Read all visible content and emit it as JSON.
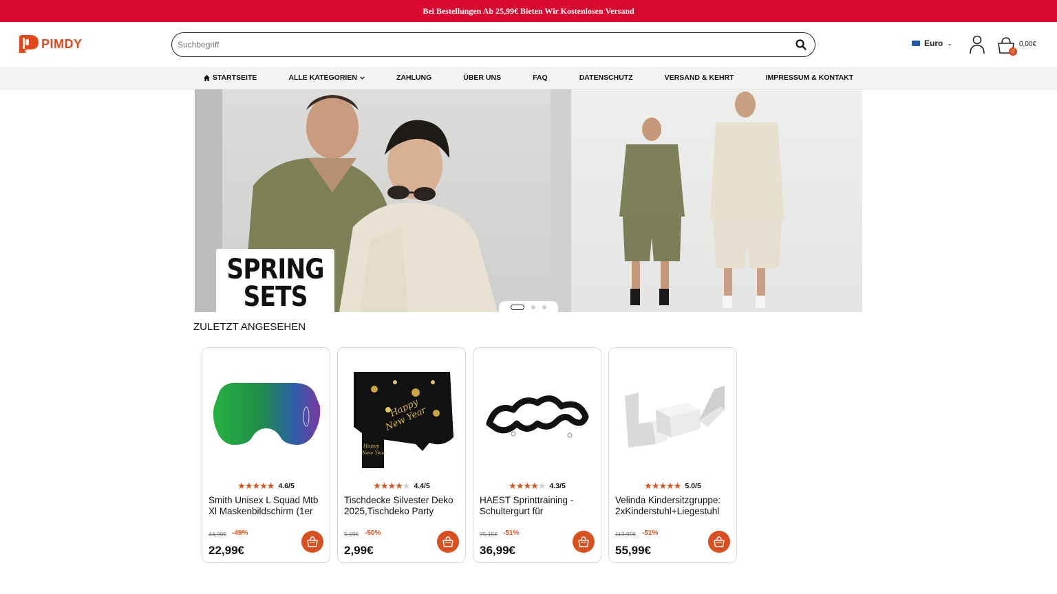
{
  "topbar": {
    "text": "Bei Bestellungen Ab 25,99€ Bieten Wir Kostenlosen Versand"
  },
  "header": {
    "logo_text": "PIMDY",
    "search": {
      "placeholder": "Suchbegriff",
      "value": ""
    },
    "currency": {
      "label": "Euro"
    },
    "cart": {
      "count": "0",
      "total": "0,00€"
    }
  },
  "nav": {
    "items": [
      {
        "label": "STARTSEITE",
        "icon": "home-icon"
      },
      {
        "label": "ALLE KATEGORIEN",
        "icon": "chevron-down-icon"
      },
      {
        "label": "ZAHLUNG"
      },
      {
        "label": "ÜBER UNS"
      },
      {
        "label": "FAQ"
      },
      {
        "label": "DATENSCHUTZ"
      },
      {
        "label": "VERSAND & KEHRT"
      },
      {
        "label": "IMPRESSUM & KONTAKT"
      }
    ]
  },
  "hero": {
    "line1": "SPRING",
    "line2": "SETS",
    "slides": 3,
    "active_slide": 1
  },
  "recent": {
    "title": "ZULETZT ANGESEHEN",
    "products": [
      {
        "title": "Smith Unisex L Squad Mtb Xl Maskenbildschirm (1er",
        "rating": "4.6/5",
        "stars": 4.6,
        "old_price": "44,99€",
        "discount": "-49%",
        "price": "22,99€",
        "image": "green-mirrored-goggle-lens"
      },
      {
        "title": "Tischdecke Silvester Deko 2025,Tischdeko Party",
        "rating": "4.4/5",
        "stars": 4.4,
        "old_price": "5,99€",
        "discount": "-50%",
        "price": "2,99€",
        "image": "black-gold-new-year-tablecloth"
      },
      {
        "title": "HAEST Sprinttraining - Schultergurt für",
        "rating": "4.3/5",
        "stars": 4.3,
        "old_price": "75,15€",
        "discount": "-51%",
        "price": "36,99€",
        "image": "black-harness-straps"
      },
      {
        "title": "Velinda Kindersitzgruppe: 2xKinderstuhl+Liegestuhl",
        "rating": "5.0/5",
        "stars": 5.0,
        "old_price": "113,99€",
        "discount": "-51%",
        "price": "55,99€",
        "image": "grey-foam-kids-furniture"
      }
    ]
  },
  "colors": {
    "topbar": "#d7092e",
    "accent": "#d8501f",
    "logo": "#e2481d"
  }
}
